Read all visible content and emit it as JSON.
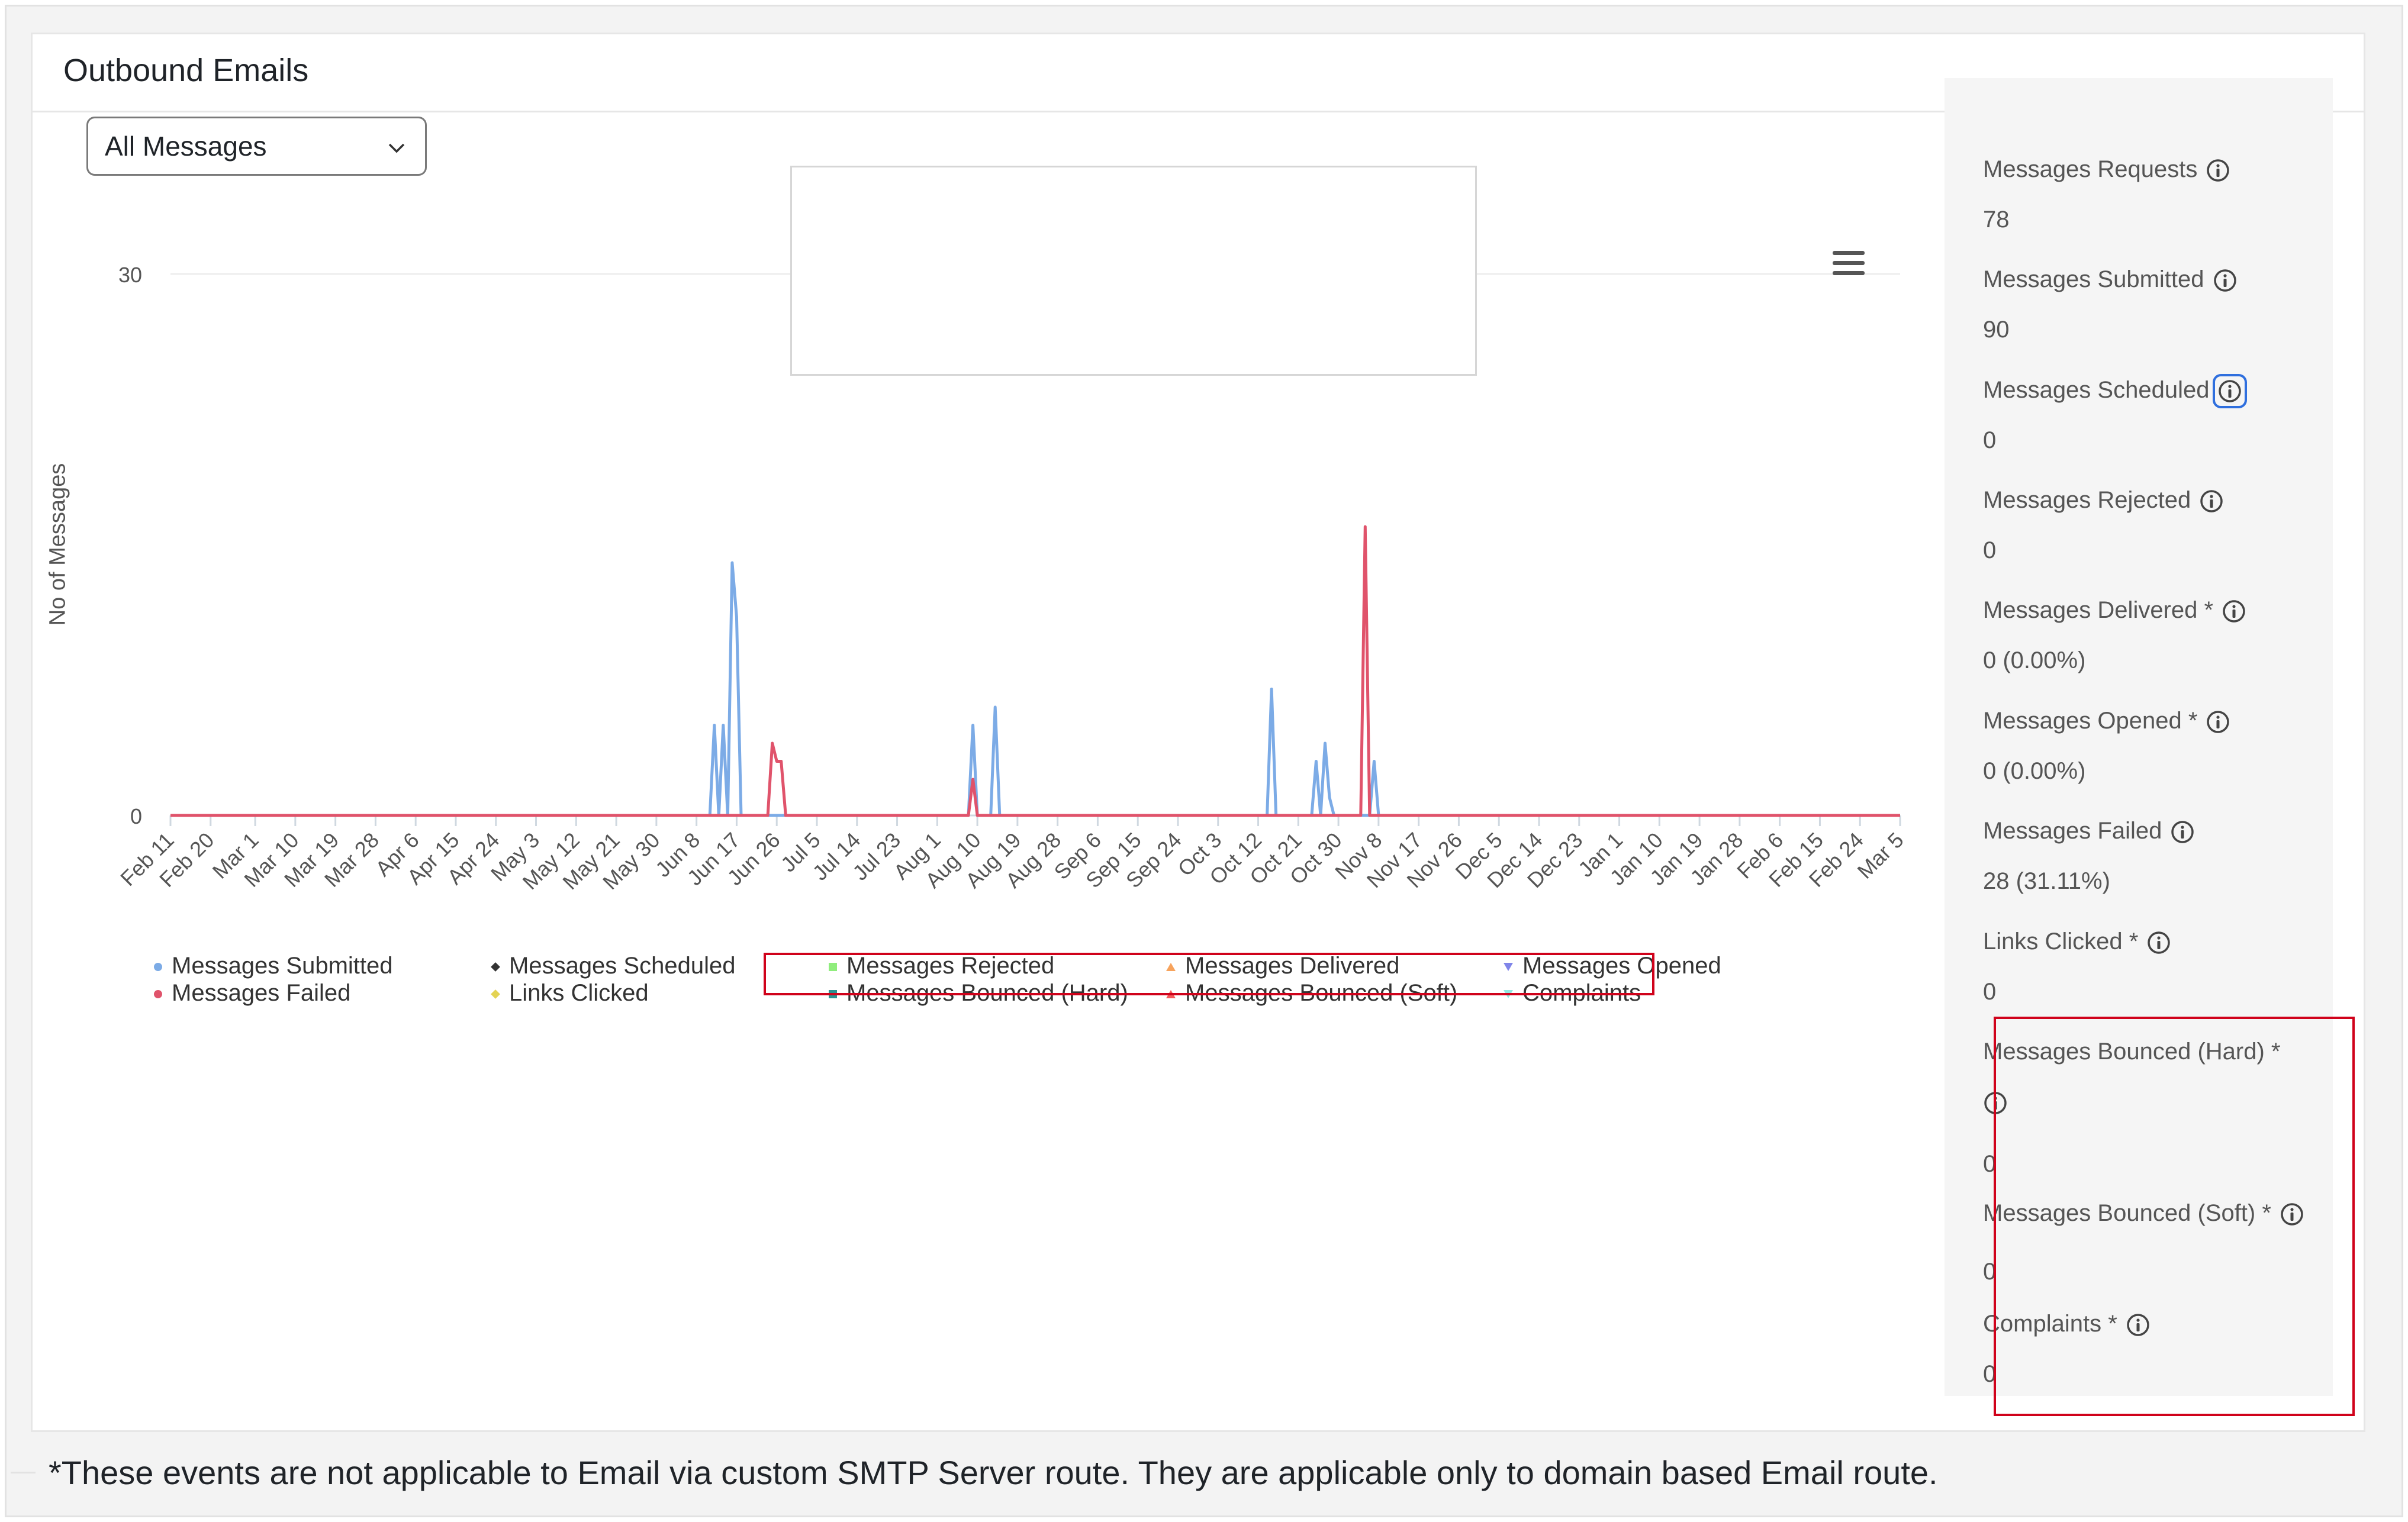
{
  "card": {
    "title": "Outbound Emails"
  },
  "filter": {
    "selected": "All Messages"
  },
  "chart_data": {
    "type": "line",
    "xlabel": "",
    "ylabel": "No of Messages",
    "ylim": [
      0,
      30
    ],
    "y_ticks": [
      "0",
      "30"
    ],
    "x_ticks": [
      "Feb 11",
      "Feb 20",
      "Mar 1",
      "Mar 10",
      "Mar 19",
      "Mar 28",
      "Apr 6",
      "Apr 15",
      "Apr 24",
      "May 3",
      "May 12",
      "May 21",
      "May 30",
      "Jun 8",
      "Jun 17",
      "Jun 26",
      "Jul 5",
      "Jul 14",
      "Jul 23",
      "Aug 1",
      "Aug 10",
      "Aug 19",
      "Aug 28",
      "Sep 6",
      "Sep 15",
      "Sep 24",
      "Oct 3",
      "Oct 12",
      "Oct 21",
      "Oct 30",
      "Nov 8",
      "Nov 17",
      "Nov 26",
      "Dec 5",
      "Dec 14",
      "Dec 23",
      "Jan 1",
      "Jan 10",
      "Jan 19",
      "Jan 28",
      "Feb 6",
      "Feb 15",
      "Feb 24",
      "Mar 5"
    ],
    "series": [
      {
        "name": "Messages Submitted",
        "color": "#7cabe6",
        "points": [
          [
            "Jun 11",
            0
          ],
          [
            "Jun 12",
            5
          ],
          [
            "Jun 13",
            0
          ],
          [
            "Jun 14",
            5
          ],
          [
            "Jun 15",
            0
          ],
          [
            "Jun 16",
            14
          ],
          [
            "Jun 17",
            11
          ],
          [
            "Jun 18",
            0
          ],
          [
            "Aug 8",
            0
          ],
          [
            "Aug 9",
            5
          ],
          [
            "Aug 10",
            0
          ],
          [
            "Aug 13",
            0
          ],
          [
            "Aug 14",
            6
          ],
          [
            "Aug 15",
            0
          ],
          [
            "Oct 14",
            0
          ],
          [
            "Oct 15",
            7
          ],
          [
            "Oct 16",
            0
          ],
          [
            "Oct 24",
            0
          ],
          [
            "Oct 25",
            3
          ],
          [
            "Oct 26",
            0
          ],
          [
            "Oct 27",
            4
          ],
          [
            "Oct 28",
            1
          ],
          [
            "Oct 29",
            0
          ],
          [
            "Nov 6",
            0
          ],
          [
            "Nov 7",
            3
          ],
          [
            "Nov 8",
            0
          ]
        ]
      },
      {
        "name": "Messages Failed",
        "color": "#e0536b",
        "points": [
          [
            "Jun 24",
            0
          ],
          [
            "Jun 25",
            4
          ],
          [
            "Jun 26",
            3
          ],
          [
            "Jun 27",
            3
          ],
          [
            "Jun 28",
            0
          ],
          [
            "Aug 8",
            0
          ],
          [
            "Aug 9",
            2
          ],
          [
            "Aug 10",
            0
          ],
          [
            "Nov 4",
            0
          ],
          [
            "Nov 5",
            16
          ],
          [
            "Nov 6",
            0
          ]
        ]
      }
    ],
    "legend": [
      {
        "name": "Messages Submitted",
        "color": "#7cabe6",
        "marker": "circle"
      },
      {
        "name": "Messages Scheduled",
        "color": "#333333",
        "marker": "diamond"
      },
      {
        "name": "Messages Rejected",
        "color": "#90ed7d",
        "marker": "square"
      },
      {
        "name": "Messages Delivered",
        "color": "#f7a35c",
        "marker": "triangle"
      },
      {
        "name": "Messages Opened",
        "color": "#8085e9",
        "marker": "triangle-down"
      },
      {
        "name": "Messages Failed",
        "color": "#e0536b",
        "marker": "circle"
      },
      {
        "name": "Links Clicked",
        "color": "#e4d354",
        "marker": "diamond"
      },
      {
        "name": "Messages Bounced (Hard)",
        "color": "#2b908f",
        "marker": "square"
      },
      {
        "name": "Messages Bounced (Soft)",
        "color": "#f45b5b",
        "marker": "triangle"
      },
      {
        "name": "Complaints",
        "color": "#91e8e1",
        "marker": "triangle-down"
      }
    ],
    "legend_placement": "bottom",
    "grid": true
  },
  "stats": [
    {
      "label": "Messages Requests",
      "value": "78"
    },
    {
      "label": "Messages Submitted",
      "value": "90"
    },
    {
      "label": "Messages Scheduled",
      "value": "0"
    },
    {
      "label": "Messages Rejected",
      "value": "0"
    },
    {
      "label": "Messages Delivered *",
      "value": "0 (0.00%)"
    },
    {
      "label": "Messages Opened *",
      "value": "0 (0.00%)"
    },
    {
      "label": "Messages Failed",
      "value": "28 (31.11%)"
    },
    {
      "label": "Links Clicked *",
      "value": "0"
    },
    {
      "label": "Messages Bounced (Hard) *",
      "value": "0"
    },
    {
      "label": "Messages Bounced (Soft) *",
      "value": "0"
    },
    {
      "label": "Complaints *",
      "value": "0"
    }
  ],
  "icons": {
    "info": "info-icon",
    "menu": "hamburger-menu-icon",
    "caret": "chevron-down-icon"
  },
  "highlight_color": "#d0021b",
  "footnote": "*These events are not applicable to Email via custom SMTP Server route. They are applicable only to domain based Email route."
}
